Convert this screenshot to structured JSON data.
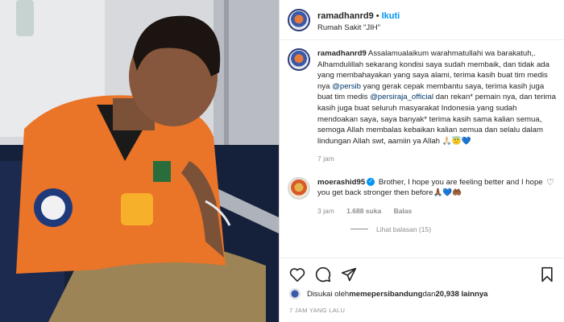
{
  "post": {
    "username": "ramadhanrd9",
    "separator": "•",
    "follow_label": "Ikuti",
    "location": "Rumah Sakit \"JIH\""
  },
  "caption": {
    "username": "ramadhanrd9",
    "part1": "Assalamualaikum warahmatullahi wa barakatuh,. Alhamdulillah sekarang kondisi saya sudah membaik, dan tidak ada yang membahayakan yang saya alami, terima kasih buat tim medis nya ",
    "mention1": "@persib",
    "part2": " yang gerak cepak membantu saya, terima kasih juga buat tim medis ",
    "mention2": "@persiraja_official",
    "part3": " dan rekan* pemain nya, dan terima kasih juga buat seluruh masyarakat Indonesia yang sudah mendoakan saya, saya banyak* terima kasih sama kalian semua, semoga Allah membalas kebaikan kalian semua dan selalu dalam lindungan Allah swt, aamiin ya Allah ",
    "emoji": "🙏🏻😇💙",
    "time": "7 jam"
  },
  "comment": {
    "username": "moerashid95",
    "verified": "✓",
    "text": " Brother, I hope you are feeling better and I hope you get back stronger then before",
    "emoji": "🙏🏾💙🤲🏾",
    "time": "3 jam",
    "likes": "1.688 suka",
    "reply": "Balas",
    "heart": "♡",
    "view_replies": "Lihat balasan (15)"
  },
  "likes": {
    "prefix": "Disukai oleh ",
    "user": "memepersibandung",
    "middle": " dan ",
    "count": "20,938 lainnya"
  },
  "timestamp": "7 JAM YANG LALU"
}
